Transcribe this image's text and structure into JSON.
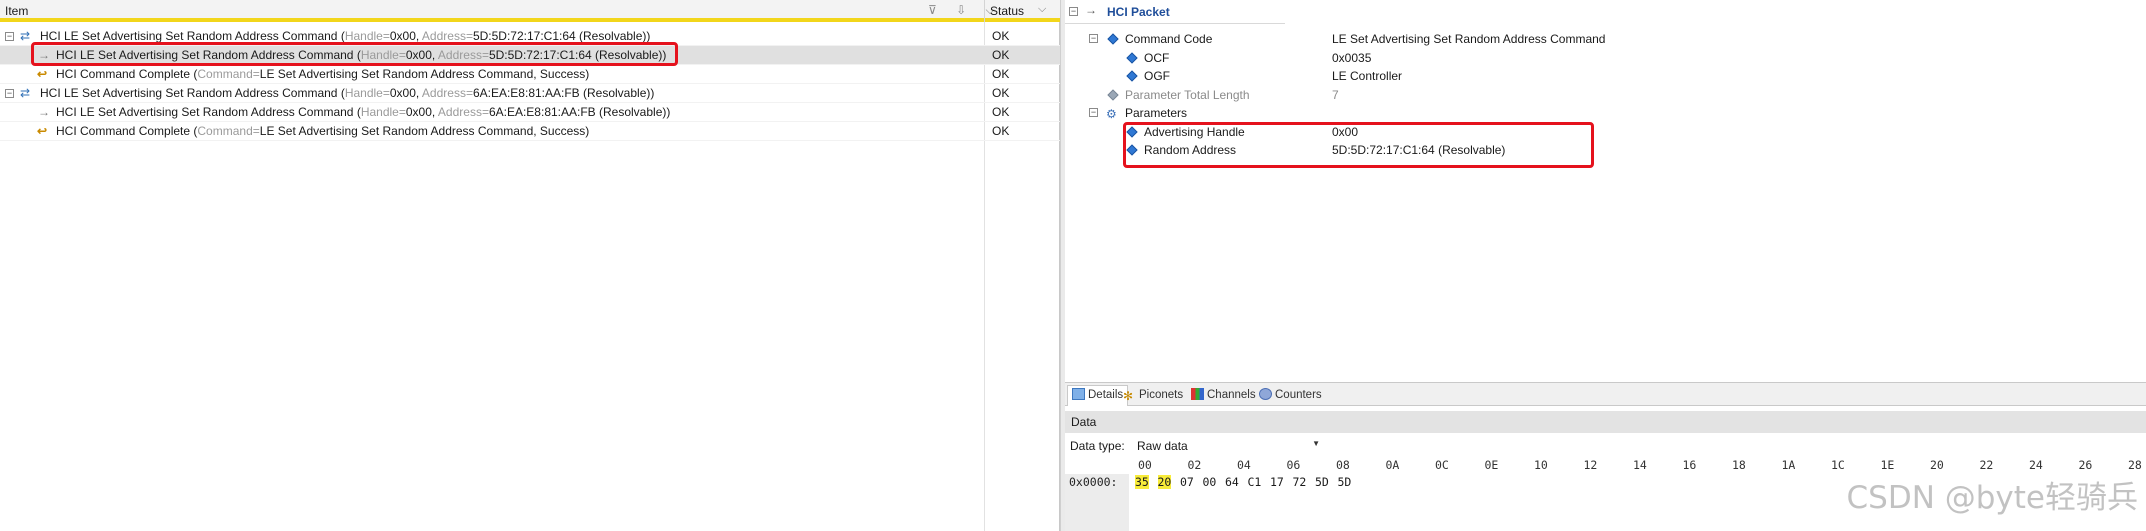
{
  "left_header": {
    "item_label": "Item",
    "status_label": "Status",
    "filter_icons": "⊽ ⇩ ⌵"
  },
  "rows": [
    {
      "icon": "group-icon",
      "expander": "−",
      "name": "HCI LE Set Advertising Set Random Address Command",
      "open": "(",
      "k1": "Handle=",
      "v1": "0x00",
      "sep": ", ",
      "k2": "Address=",
      "v2": "5D:5D:72:17:C1:64 (Resolvable)",
      "close": ")",
      "status": "OK"
    },
    {
      "icon": "arrow-icon",
      "name": "HCI LE Set Advertising Set Random Address Command",
      "open": "(",
      "k1": "Handle=",
      "v1": "0x00",
      "sep": ", ",
      "k2": "Address=",
      "v2": "5D:5D:72:17:C1:64 (Resolvable)",
      "close": ")",
      "status": "OK"
    },
    {
      "icon": "complete-icon",
      "name": "HCI Command Complete",
      "open": "(",
      "k1": "Command=",
      "v1": "LE Set Advertising Set Random Address Command",
      "sep": ", ",
      "k2": "",
      "v2": "Success",
      "close": ")",
      "status": "OK"
    },
    {
      "icon": "group-icon",
      "expander": "−",
      "name": "HCI LE Set Advertising Set Random Address Command",
      "open": "(",
      "k1": "Handle=",
      "v1": "0x00",
      "sep": ", ",
      "k2": "Address=",
      "v2": "6A:EA:E8:81:AA:FB (Resolvable)",
      "close": ")",
      "status": "OK"
    },
    {
      "icon": "arrow-icon",
      "name": "HCI LE Set Advertising Set Random Address Command",
      "open": "(",
      "k1": "Handle=",
      "v1": "0x00",
      "sep": ", ",
      "k2": "Address=",
      "v2": "6A:EA:E8:81:AA:FB (Resolvable)",
      "close": ")",
      "status": "OK"
    },
    {
      "icon": "complete-icon",
      "name": "HCI Command Complete",
      "open": "(",
      "k1": "Command=",
      "v1": "LE Set Advertising Set Random Address Command",
      "sep": ", ",
      "k2": "",
      "v2": "Success",
      "close": ")",
      "status": "OK"
    }
  ],
  "detail": {
    "title": "HCI Packet",
    "expander": "−",
    "tree": [
      {
        "label": "Command Code",
        "value": "LE Set Advertising Set Random Address Command",
        "expander": "−"
      },
      {
        "label": "OCF",
        "value": "0x0035"
      },
      {
        "label": "OGF",
        "value": "LE Controller"
      },
      {
        "label": "Parameter Total Length",
        "value": "7"
      },
      {
        "label": "Parameters",
        "value": "",
        "expander": "−"
      },
      {
        "label": "Advertising Handle",
        "value": "0x00"
      },
      {
        "label": "Random Address",
        "value": "5D:5D:72:17:C1:64 (Resolvable)"
      }
    ]
  },
  "tabs": [
    {
      "label": "Details",
      "icon": "details-icon"
    },
    {
      "label": "Piconets",
      "icon": "piconets-icon"
    },
    {
      "label": "Channels",
      "icon": "channels-icon"
    },
    {
      "label": "Counters",
      "icon": "counters-icon"
    }
  ],
  "data_panel": {
    "section_label": "Data",
    "type_label": "Data type:",
    "type_value": "Raw data",
    "hex_columns": [
      "00",
      "02",
      "04",
      "06",
      "08",
      "0A",
      "0C",
      "0E",
      "10",
      "12",
      "14",
      "16",
      "18",
      "1A",
      "1C",
      "1E",
      "20",
      "22",
      "24",
      "26",
      "28"
    ],
    "offset": "0x0000:",
    "bytes": [
      "35",
      "20",
      "07",
      "00",
      "64",
      "C1",
      "17",
      "72",
      "5D",
      "5D"
    ]
  },
  "watermark": "CSDN @byte轻骑兵",
  "colors": {
    "highlight_box": "#e5121d",
    "header_accent": "#f2d61b",
    "byte_highlight": "#f8ec3a",
    "detail_title": "#1f4e9a"
  }
}
